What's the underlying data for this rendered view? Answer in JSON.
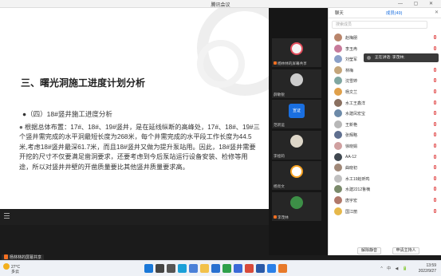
{
  "window": {
    "title": "腾讯会议"
  },
  "slide": {
    "heading": "三、曙光洞施工进度计划分析",
    "subhead": "●（四）18#竖井施工进度分析",
    "bullet": "●",
    "body": "根据总体布置：17#、18#、19#竖井，是在延线纵断的高峰处，17#、18#、19#三个竖井需完成的水平洞最短长度为268米，每个井需完成的水平段工作长度为44.5米,考虑18#竖井最深61.7米，而且18#竖井又做为提升泵站用。因此，18#竖井需要开挖的尺寸不仅要满足凿洞要求，还要考虑到今后泵站运行设备安装、检修等用途，所以对竖井井壁的开凿质量要比其他竖井质量要求高。"
  },
  "share_badge": "杨林林的屏幕共享",
  "videos": [
    {
      "name": "杨林林的屏幕共享",
      "avatar_color": "#f4f4f4",
      "accent": "#e04b5a",
      "mic_on": true
    },
    {
      "name": "薛敏锐",
      "avatar_color": "#cccccc",
      "accent": "#cccccc",
      "mic_on": false
    },
    {
      "name": "范新运",
      "avatar_color": "#1a6fe0",
      "accent": "#1a6fe0",
      "label": "宣证",
      "mic_on": false
    },
    {
      "name": "李娅莉",
      "avatar_color": "#ddd6c8",
      "accent": "#ddd6c8",
      "mic_on": false
    },
    {
      "name": "杨亮文",
      "avatar_color": "#ffffff",
      "accent": "#f5a020",
      "mic_on": false
    },
    {
      "name": "李茂林",
      "avatar_color": "#3d8f47",
      "accent": "#3d8f47",
      "mic_on": true
    }
  ],
  "panel": {
    "tabs": [
      "聊天",
      "成员(49)"
    ],
    "search_placeholder": "搜索成员",
    "speaking": "正在讲话: 李茂林;",
    "members": [
      {
        "name": "赵梅朋",
        "color": "#b9856b"
      },
      {
        "name": "李玉冉",
        "color": "#c77a9a"
      },
      {
        "name": "刘莹军",
        "color": "#8aa0c8"
      },
      {
        "name": "林梅",
        "color": "#c4a57a"
      },
      {
        "name": "沈雪婷",
        "color": "#7fa6a0"
      },
      {
        "name": "杨文兰",
        "color": "#e0a04a"
      },
      {
        "name": "水工王鑫洋",
        "color": "#8a7060"
      },
      {
        "name": "水建凤宏宝",
        "color": "#6c8aa8"
      },
      {
        "name": "王新艳",
        "color": "#b7b7b7"
      },
      {
        "name": "张辉略",
        "color": "#5f6f8f"
      },
      {
        "name": "徐晓娟",
        "color": "#d0a0a0"
      },
      {
        "name": "AA-12",
        "color": "#404850"
      },
      {
        "name": "曲晓初",
        "color": "#a08878"
      },
      {
        "name": "水工19赵昕鸣",
        "color": "#c0c0c0"
      },
      {
        "name": "水建2212鲁楠",
        "color": "#7a8a6a"
      },
      {
        "name": "唐宇宏",
        "color": "#b0786a"
      },
      {
        "name": "国江丽",
        "color": "#e6b84a"
      }
    ],
    "buttons": [
      "解除静音",
      "申请主持人"
    ]
  },
  "taskbar": {
    "temp": "27°C",
    "weather": "多云",
    "time": "13:59",
    "date": "2022/9/27",
    "tray": "^ 中 ◀ 🔋",
    "apps": [
      {
        "name": "start",
        "color": "#1a78d8"
      },
      {
        "name": "search",
        "color": "#444444"
      },
      {
        "name": "taskview",
        "color": "#555555"
      },
      {
        "name": "edge",
        "color": "#1aa0d8"
      },
      {
        "name": "store",
        "color": "#4a80d8"
      },
      {
        "name": "explorer",
        "color": "#f2c14a"
      },
      {
        "name": "mail",
        "color": "#2870d0"
      },
      {
        "name": "app-green",
        "color": "#2ea04a"
      },
      {
        "name": "app-blue",
        "color": "#3a6ad8"
      },
      {
        "name": "app-red",
        "color": "#d84a3a"
      },
      {
        "name": "app-word",
        "color": "#2a5aa8"
      },
      {
        "name": "app-meeting",
        "color": "#2a80e8"
      },
      {
        "name": "app-orange",
        "color": "#e87a2a"
      }
    ]
  }
}
